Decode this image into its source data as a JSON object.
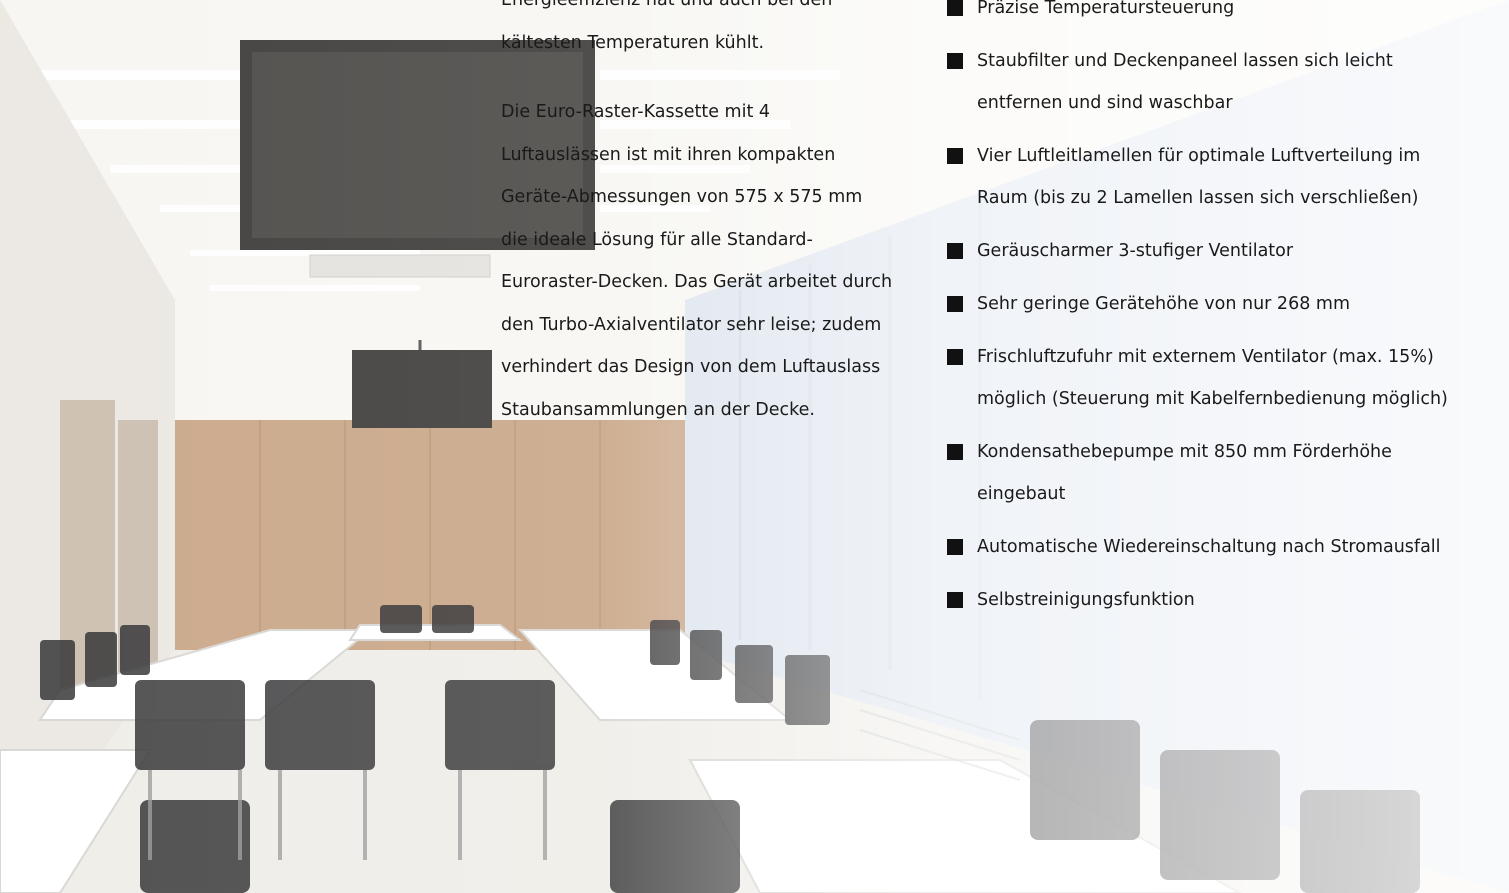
{
  "colors": {
    "text": "#1a1a1a",
    "bullet": "#111111",
    "wall_wood": "#c9a687",
    "ceiling": "#f6f5f1",
    "curtain": "#dfe6ef"
  },
  "description": {
    "paragraph_1_lines": [
      "Energieeffizienz hat und auch bei den",
      "kältesten Temperaturen kühlt."
    ],
    "paragraph_2_lines": [
      "Die Euro-Raster-Kassette mit 4",
      "Luftauslässen ist mit ihren kompakten",
      "Geräte-Abmessungen von 575 x 575 mm",
      "die ideale Lösung für alle Standard-",
      "Euroraster-Decken. Das Gerät arbeitet durch",
      "den Turbo-Axialventilator sehr leise; zudem",
      "verhindert das Design von dem Luftauslass",
      "Staubansammlungen an der Decke."
    ]
  },
  "features": [
    {
      "lines": [
        "Präzise Temperatursteuerung"
      ]
    },
    {
      "lines": [
        "Staubfilter und Deckenpaneel lassen sich leicht",
        "entfernen und sind waschbar"
      ]
    },
    {
      "lines": [
        "Vier Luftleitlamellen für optimale Luftverteilung im",
        "Raum (bis zu 2 Lamellen lassen sich verschließen)"
      ]
    },
    {
      "lines": [
        "Geräuscharmer 3-stufiger Ventilator"
      ]
    },
    {
      "lines": [
        "Sehr geringe Gerätehöhe von nur 268 mm"
      ]
    },
    {
      "lines": [
        "Frischluftzufuhr mit externem Ventilator (max. 15%)",
        "möglich (Steuerung mit Kabelfernbedienung möglich)"
      ]
    },
    {
      "lines": [
        "Kondensathebepumpe mit 850 mm Förderhöhe",
        "eingebaut"
      ]
    },
    {
      "lines": [
        "Automatische Wiedereinschaltung nach Stromausfall"
      ]
    },
    {
      "lines": [
        "Selbstreinigungsfunktion"
      ]
    }
  ]
}
